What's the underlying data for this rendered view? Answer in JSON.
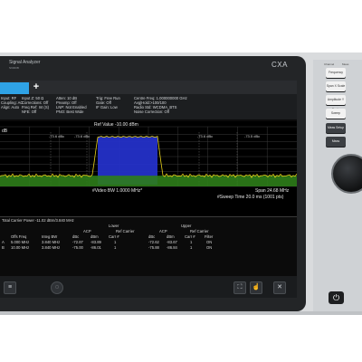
{
  "instrument": {
    "brand": "Signal Analyzer",
    "series": "N9000B",
    "model": "CXA"
  },
  "tabs": {
    "add": "+"
  },
  "info": {
    "col1": "Input: RF\nCoupling: AC\nAlign: Auto",
    "col2": "Input Z: 50 Ω\nCorrections: Off\nFreq Ref: Int (S)\nNFE: Off",
    "col3": "Atten: 10 dB\nPreamp: Off\nLNP: Not Enabled\nPNO: Best Wide",
    "col4": "Trig: Free Run\nGate: Off\nIF Gain: Low",
    "col5": "Centre Freq: 1.000000000 GHz\nAvg|Hold:>100/100\nRadio Std: WCDMA_BTS\nNoise Correction: Off"
  },
  "plot": {
    "ref_label": "Ref Value -10.00 dBm",
    "scale_label": "dB",
    "peak_labels": [
      "-73.6 dBc",
      "-73.6 dBc",
      "-73.6 dBc",
      "-73.5 dBc"
    ],
    "vbw_label": "#Video BW 1.0000 MHz*",
    "span_label": "Span 24.68 MHz",
    "sweep_label": "#Sweep Time 20.0 ms (1001 pts)"
  },
  "table": {
    "total_power": "Total Carrier Power -11.02 dBm/3.840 MHz",
    "group_lower": "Lower",
    "group_upper": "Upper",
    "sub_acp": "ACP",
    "sub_refc": "Ref Carrier",
    "headers": [
      "Offs Freq",
      "Integ BW",
      "dBc",
      "dBm",
      "Carr #",
      "dBc",
      "dBm",
      "Carr #",
      "Filter"
    ],
    "rows": [
      [
        "A",
        "5.000 MHz",
        "3.840 MHz",
        "-72.87",
        "-83.89",
        "1",
        "-72.62",
        "-83.67",
        "1",
        "ON"
      ],
      [
        "B",
        "10.00 MHz",
        "3.840 MHz",
        "-75.00",
        "-86.01",
        "1",
        "-75.88",
        "-86.84",
        "1",
        "ON"
      ]
    ]
  },
  "panel": {
    "heads": [
      "Channel",
      "Trace",
      "Marker",
      "Peak",
      "Meas"
    ],
    "keys": [
      "Frequency",
      "Span X Scale",
      "Amplitude Y Scale",
      "Sweep",
      "Meas Setup",
      "Meas",
      "Mode Meas",
      "Marker"
    ]
  },
  "trace": {
    "noise_level": 0.82,
    "channel_level": 0.32,
    "colors": {
      "trace": "#e8d21a",
      "channel": "#2430c8",
      "floor": "#2e7d1a",
      "grid": "#3a3a3a"
    }
  }
}
